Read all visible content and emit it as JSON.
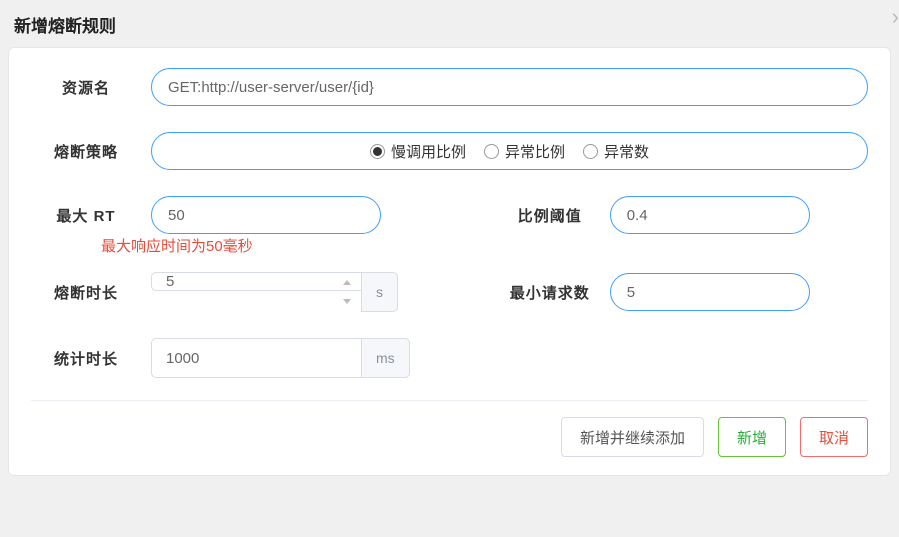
{
  "title": "新增熔断规则",
  "labels": {
    "resource": "资源名",
    "strategy": "熔断策略",
    "max_rt": "最大 RT",
    "ratio_threshold": "比例阈值",
    "break_duration": "熔断时长",
    "min_requests": "最小请求数",
    "stat_duration": "统计时长"
  },
  "fields": {
    "resource_value": "GET:http://user-server/user/{id}",
    "strategy_options": {
      "slow_ratio": "慢调用比例",
      "error_ratio": "异常比例",
      "error_count": "异常数"
    },
    "strategy_selected": "slow_ratio",
    "max_rt_value": "50",
    "max_rt_note": "最大响应时间为50毫秒",
    "ratio_threshold_value": "0.4",
    "break_duration_value": "5",
    "break_duration_unit": "s",
    "min_requests_value": "5",
    "stat_duration_value": "1000",
    "stat_duration_unit": "ms"
  },
  "buttons": {
    "add_continue": "新增并继续添加",
    "add": "新增",
    "cancel": "取消"
  }
}
